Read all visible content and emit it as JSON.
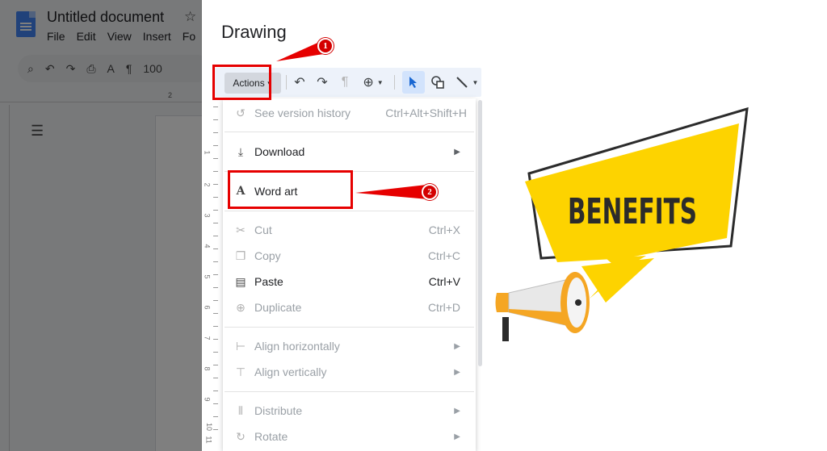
{
  "docs": {
    "title": "Untitled document",
    "menu": [
      "File",
      "Edit",
      "View",
      "Insert",
      "Fo"
    ],
    "zoom": "100",
    "ruler_mark": "2"
  },
  "dialog": {
    "title": "Drawing",
    "actions_label": "Actions"
  },
  "menu": {
    "items": [
      {
        "icon": "history-icon",
        "label": "See version history",
        "shortcut": "Ctrl+Alt+Shift+H",
        "enabled": false
      },
      {
        "icon": "download-icon",
        "label": "Download",
        "submenu": true,
        "enabled": true
      },
      {
        "icon": "word-art-icon",
        "label": "Word art",
        "enabled": true
      },
      {
        "icon": "scissors-icon",
        "label": "Cut",
        "shortcut": "Ctrl+X",
        "enabled": false
      },
      {
        "icon": "copy-icon",
        "label": "Copy",
        "shortcut": "Ctrl+C",
        "enabled": false
      },
      {
        "icon": "clipboard-icon",
        "label": "Paste",
        "shortcut": "Ctrl+V",
        "enabled": true
      },
      {
        "icon": "duplicate-icon",
        "label": "Duplicate",
        "shortcut": "Ctrl+D",
        "enabled": false
      },
      {
        "icon": "align-horizontal-icon",
        "label": "Align horizontally",
        "submenu": true,
        "enabled": false
      },
      {
        "icon": "align-vertical-icon",
        "label": "Align vertically",
        "submenu": true,
        "enabled": false
      },
      {
        "icon": "distribute-icon",
        "label": "Distribute",
        "submenu": true,
        "enabled": false
      },
      {
        "icon": "rotate-icon",
        "label": "Rotate",
        "submenu": true,
        "enabled": false
      }
    ]
  },
  "annotations": {
    "step1": "1",
    "step2": "2",
    "color": "#e60000"
  },
  "illustration": {
    "text": "BENEFITS",
    "color_yellow": "#fdd300",
    "color_dark": "#2b2b2b",
    "color_orange": "#f5a623"
  },
  "ruler_numbers": [
    "1",
    "2",
    "3",
    "4",
    "5",
    "6",
    "7",
    "8",
    "9",
    "10",
    "11"
  ]
}
